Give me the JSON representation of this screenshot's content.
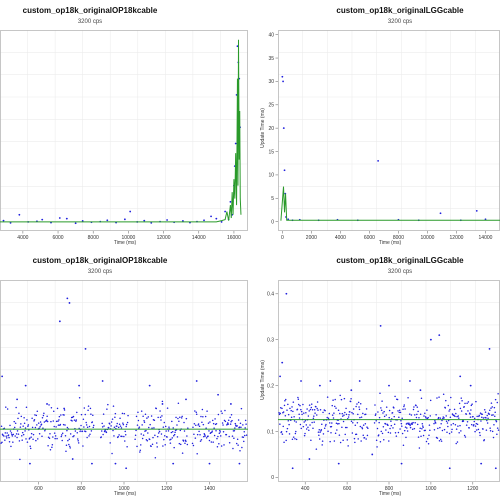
{
  "chart_data": [
    {
      "type": "scatter",
      "title": "custom_op18k_originalOP18kcable",
      "subtitle": "3200 cps",
      "xlabel": "Time (ms)",
      "ylabel": "",
      "xlim": [
        2700,
        16800
      ],
      "ylim": [
        -2,
        60
      ],
      "xticks": [
        4000,
        6000,
        8000,
        10000,
        12000,
        14000,
        16000
      ],
      "yticks": [],
      "grid": true,
      "series": [
        {
          "kind": "points",
          "color": "#1f1fdd",
          "x": [
            2900,
            3300,
            3800,
            4300,
            4800,
            5100,
            5600,
            6100,
            6500,
            7000,
            7400,
            7900,
            8400,
            8800,
            9300,
            9800,
            10100,
            10500,
            10900,
            11300,
            11800,
            12200,
            12600,
            13100,
            13500,
            13900,
            14300,
            14700,
            15000,
            15300,
            15500,
            15700,
            15800,
            15900,
            16000,
            16050,
            16100,
            16150,
            16200,
            16250,
            16300,
            16350
          ],
          "y": [
            1.2,
            0.5,
            3,
            0.8,
            1,
            1.5,
            0.6,
            2,
            1.8,
            0.4,
            1.1,
            0.7,
            0.9,
            1.3,
            0.6,
            1.6,
            4,
            0.8,
            1.2,
            0.5,
            0.9,
            1.4,
            0.7,
            1.1,
            0.6,
            0.9,
            1.3,
            2.5,
            1.8,
            0.8,
            4,
            1.6,
            7,
            3,
            12,
            18,
            25,
            40,
            55,
            50,
            45,
            30
          ]
        },
        {
          "kind": "line",
          "color": "#2a9a2a",
          "x": [
            2700,
            15000,
            15300,
            15500,
            15600,
            15700,
            15800,
            15850,
            15900,
            15950,
            16000,
            16050,
            16100,
            16150,
            16200,
            16230,
            16260,
            16300,
            16330,
            16360,
            16400
          ],
          "y": [
            0.8,
            0.8,
            1.2,
            1.5,
            4,
            1.2,
            6,
            2,
            10,
            3,
            14,
            8,
            22,
            6,
            45,
            12,
            57,
            20,
            35,
            8,
            3
          ]
        }
      ]
    },
    {
      "type": "scatter",
      "title": "custom_op18k_originalLGGcable",
      "subtitle": "3200 cps",
      "xlabel": "Time (ms)",
      "ylabel": "Update Time (ms)",
      "xlim": [
        -300,
        15000
      ],
      "ylim": [
        -2,
        41
      ],
      "xticks": [
        0,
        2000,
        4000,
        6000,
        8000,
        10000,
        12000,
        14000
      ],
      "yticks": [
        0,
        5,
        10,
        15,
        20,
        25,
        30,
        35,
        40
      ],
      "grid": true,
      "series": [
        {
          "kind": "points",
          "color": "#1f1fdd",
          "x": [
            0,
            50,
            100,
            150,
            200,
            250,
            400,
            700,
            1200,
            2500,
            3800,
            5200,
            6600,
            8000,
            9400,
            10900,
            12300,
            13400,
            14000
          ],
          "y": [
            31,
            30,
            20,
            11,
            6,
            1,
            0.5,
            0.3,
            0.4,
            0.3,
            0.4,
            0.3,
            13,
            0.4,
            0.3,
            1.8,
            0.3,
            2.3,
            0.5
          ]
        },
        {
          "kind": "line",
          "color": "#2a9a2a",
          "x": [
            -100,
            80,
            150,
            220,
            300,
            15000
          ],
          "y": [
            0.2,
            7.5,
            2,
            6,
            0.3,
            0.3
          ]
        }
      ]
    },
    {
      "type": "scatter",
      "title": "custom_op18k_originalOP18kcable",
      "subtitle": "3200 cps",
      "xlabel": "Time (ms)",
      "ylabel": "",
      "xlim": [
        420,
        1580
      ],
      "ylim": [
        0.04,
        0.48
      ],
      "xticks": [
        600,
        800,
        1000,
        1200,
        1400
      ],
      "yticks": [],
      "grid": true,
      "band": {
        "center": 0.155,
        "spread": 0.045,
        "gaps": [
          [
            860,
            890
          ],
          [
            1020,
            1050
          ],
          [
            1300,
            1320
          ]
        ],
        "step": 2.2,
        "seed": 11
      },
      "trend": {
        "value": 0.155,
        "color": "#2a9a2a"
      },
      "outliers": {
        "color": "#1f1fdd",
        "x": [
          430,
          500,
          540,
          560,
          640,
          700,
          720,
          735,
          745,
          760,
          790,
          820,
          850,
          900,
          960,
          1010,
          1120,
          1180,
          1230,
          1290,
          1340,
          1400,
          1440,
          1500,
          1540
        ],
        "y": [
          0.27,
          0.22,
          0.25,
          0.08,
          0.21,
          0.39,
          0.2,
          0.44,
          0.43,
          0.09,
          0.25,
          0.33,
          0.08,
          0.26,
          0.08,
          0.07,
          0.25,
          0.21,
          0.08,
          0.22,
          0.26,
          0.08,
          0.23,
          0.21,
          0.08
        ]
      }
    },
    {
      "type": "scatter",
      "title": "custom_op18k_originalLGGcable",
      "subtitle": "3200 cps",
      "xlabel": "Time (ms)",
      "ylabel": "Update Time (ms)",
      "xlim": [
        270,
        1330
      ],
      "ylim": [
        -0.01,
        0.43
      ],
      "xticks": [
        400,
        600,
        800,
        1000,
        1200
      ],
      "yticks": [
        0,
        0.1,
        0.2,
        0.3,
        0.4
      ],
      "grid": true,
      "band": {
        "center": 0.125,
        "spread": 0.045,
        "gaps": [
          [
            700,
            730
          ],
          [
            1000,
            1015
          ]
        ],
        "step": 2.0,
        "seed": 29
      },
      "trend": {
        "value": 0.126,
        "color": "#2a9a2a"
      },
      "outliers": {
        "color": "#1f1fdd",
        "x": [
          280,
          290,
          310,
          340,
          380,
          420,
          470,
          520,
          560,
          620,
          660,
          720,
          760,
          800,
          860,
          900,
          950,
          1000,
          1040,
          1090,
          1140,
          1190,
          1240,
          1280,
          1310
        ],
        "y": [
          0.22,
          0.25,
          0.4,
          0.02,
          0.21,
          0.04,
          0.2,
          0.21,
          0.03,
          0.19,
          0.21,
          0.05,
          0.33,
          0.2,
          0.03,
          0.21,
          0.19,
          0.3,
          0.31,
          0.02,
          0.22,
          0.2,
          0.03,
          0.28,
          0.02
        ]
      }
    }
  ]
}
